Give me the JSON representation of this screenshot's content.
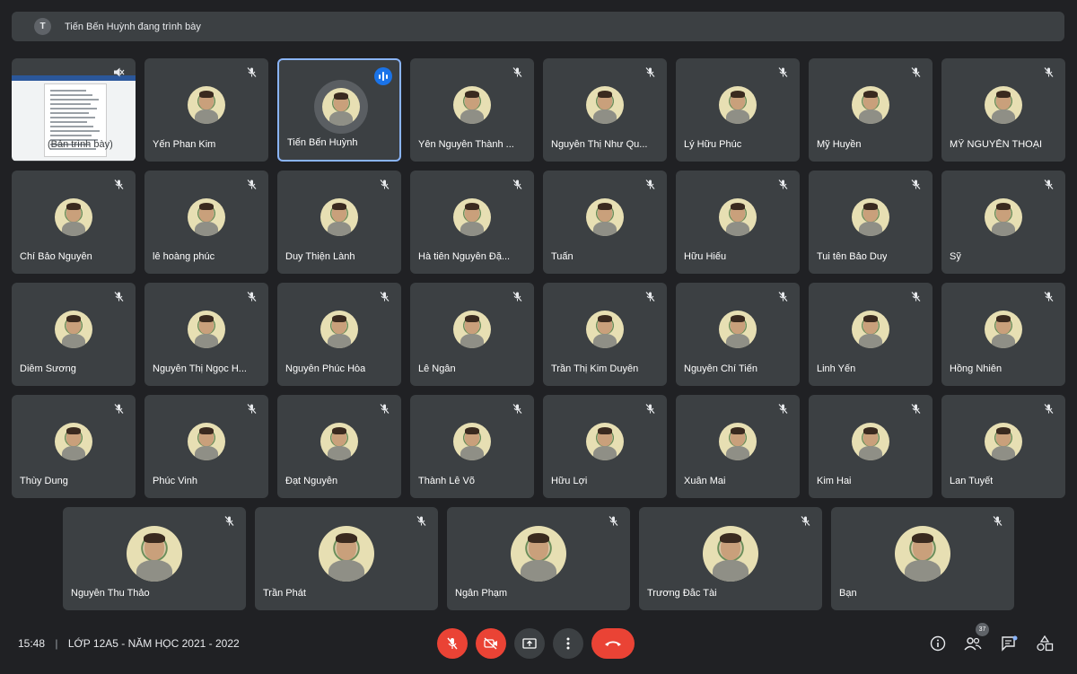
{
  "banner": {
    "avatar_initial": "T",
    "text": "Tiến Bến Huỳnh đang trình bày"
  },
  "presentation_tile": {
    "label": "(Bản trình bày)"
  },
  "speaker_tile": {
    "name": "Tiến Bến Huỳnh"
  },
  "participants_row1": [
    "Yến Phan Kim",
    "Yên Nguyễn Thành ...",
    "Nguyễn Thị Như Qu...",
    "Lý Hữu Phúc",
    "Mỹ Huyền",
    "MỸ NGUYỄN THOẠI"
  ],
  "participants_row2": [
    "Chí Bảo Nguyễn",
    "lê hoàng phúc",
    "Duy Thiện Lành",
    "Hà tiên Nguyễn Đặ...",
    "Tuấn",
    "Hữu Hiếu",
    "Tui tên Bảo Duy",
    "Sỹ"
  ],
  "participants_row3": [
    "Diễm Sương",
    "Nguyễn Thị Ngọc H...",
    "Nguyễn Phúc Hòa",
    "Lê Ngân",
    "Trần Thị Kim Duyên",
    "Nguyễn Chí Tiến",
    "Linh Yến",
    "Hồng Nhiên"
  ],
  "participants_row4": [
    "Thùy Dung",
    "Phúc Vinh",
    "Đạt Nguyễn",
    "Thành Lễ Võ",
    "Hữu Lợi",
    "Xuân Mai",
    "Kim Hai",
    "Lan Tuyết"
  ],
  "participants_row5": [
    "Nguyễn Thu Thảo",
    "Trần Phát",
    "Ngân Phạm",
    "Trương Đắc Tài",
    "Bạn"
  ],
  "footer": {
    "time": "15:48",
    "separator": "|",
    "meeting_title": "LỚP 12A5 - NĂM HỌC 2021 - 2022",
    "participant_count": "37"
  },
  "colors": {
    "background": "#202124",
    "tile": "#3c4043",
    "accent": "#1a73e8",
    "danger": "#ea4335"
  }
}
